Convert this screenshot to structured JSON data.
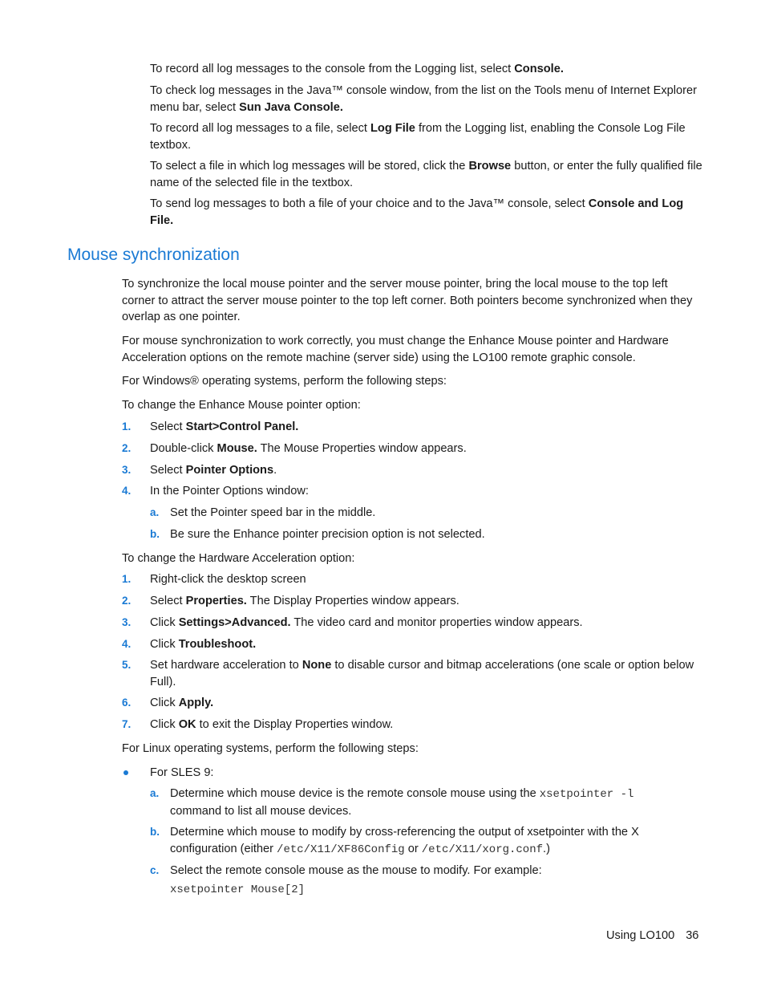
{
  "intro": [
    {
      "pre": "To record all log messages to the console from the Logging list, select ",
      "bold": "Console.",
      "post": ""
    },
    {
      "pre": "To check log messages in the Java™ console window, from the list on the Tools menu of Internet Explorer menu bar, select ",
      "bold": "Sun Java Console.",
      "post": ""
    },
    {
      "pre": "To record all log messages to a file, select ",
      "bold": "Log File",
      "post": " from the Logging list, enabling the Console Log File textbox."
    },
    {
      "pre": "To select a file in which log messages will be stored, click the ",
      "bold": "Browse",
      "post": " button, or enter the fully qualified file name of the selected file in the textbox."
    },
    {
      "pre": "To send log messages to both a file of your choice and to the Java™ console, select ",
      "bold": "Console and Log File.",
      "post": ""
    }
  ],
  "section": {
    "title": "Mouse synchronization",
    "para1": "To synchronize the local mouse pointer and the server mouse pointer, bring the local mouse to the top left corner to attract the server mouse pointer to the top left corner. Both pointers become synchronized when they overlap as one pointer.",
    "para2": "For mouse synchronization to work correctly, you must change the Enhance Mouse pointer and Hardware Acceleration options on the remote machine (server side) using the LO100 remote graphic console.",
    "para3": "For Windows® operating systems, perform the following steps:",
    "para4": "To change the Enhance Mouse pointer option:",
    "mouse_steps": [
      {
        "n": "1.",
        "pre": "Select ",
        "bold": "Start>Control Panel.",
        "post": ""
      },
      {
        "n": "2.",
        "pre": "Double-click ",
        "bold": "Mouse.",
        "post": " The Mouse Properties window appears."
      },
      {
        "n": "3.",
        "pre": "Select ",
        "bold": "Pointer Options",
        "post": "."
      },
      {
        "n": "4.",
        "pre": "In the Pointer Options window:",
        "bold": "",
        "post": ""
      }
    ],
    "mouse_substeps": [
      {
        "n": "a.",
        "text": "Set the Pointer speed bar in the middle."
      },
      {
        "n": "b.",
        "text": "Be sure the Enhance pointer precision option is not selected."
      }
    ],
    "para5": "To change the Hardware Acceleration option:",
    "hw_steps": [
      {
        "n": "1.",
        "pre": "Right-click the desktop screen",
        "bold": "",
        "post": ""
      },
      {
        "n": "2.",
        "pre": "Select ",
        "bold": "Properties.",
        "post": " The Display Properties window appears."
      },
      {
        "n": "3.",
        "pre": "Click ",
        "bold": "Settings>Advanced.",
        "post": " The video card and monitor properties window appears."
      },
      {
        "n": "4.",
        "pre": "Click ",
        "bold": "Troubleshoot.",
        "post": ""
      },
      {
        "n": "5.",
        "pre": "Set hardware acceleration to ",
        "bold": "None",
        "post": " to disable cursor and bitmap accelerations (one scale or option below Full)."
      },
      {
        "n": "6.",
        "pre": "Click ",
        "bold": "Apply.",
        "post": ""
      },
      {
        "n": "7.",
        "pre": "Click ",
        "bold": "OK",
        "post": " to exit the Display Properties window."
      }
    ],
    "para6": "For Linux operating systems, perform the following steps:",
    "bullet": "For SLES 9:",
    "linux_a_pre": "Determine which mouse device is the remote console mouse using the ",
    "linux_a_code": "xsetpointer -l",
    "linux_a_post": " command to list all mouse devices.",
    "linux_b_pre": "Determine which mouse to modify by cross-referencing the output of xsetpointer with the X configuration (either ",
    "linux_b_code1": "/etc/X11/XF86Config",
    "linux_b_mid": " or ",
    "linux_b_code2": "/etc/X11/xorg.conf",
    "linux_b_post": ".)",
    "linux_c": "Select the remote console mouse as the mouse to modify. For example:",
    "linux_c_code": "xsetpointer Mouse[2]",
    "labels": {
      "a": "a.",
      "b": "b.",
      "c": "c."
    }
  },
  "footer": {
    "section": "Using LO100",
    "page": "36"
  }
}
